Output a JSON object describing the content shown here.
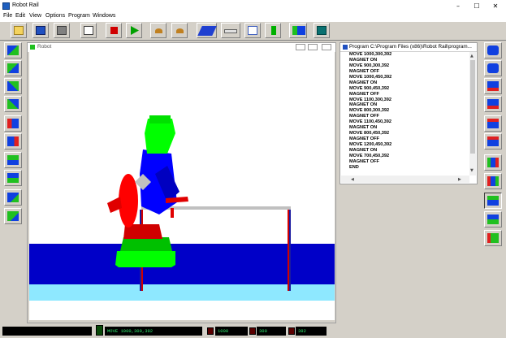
{
  "app": {
    "title": "Robot Rail"
  },
  "window_controls": {
    "minimize": "–",
    "maximize": "☐",
    "close": "✕"
  },
  "menu": [
    "File",
    "Edit",
    "View",
    "Options",
    "Program",
    "Windows"
  ],
  "robot_window": {
    "title": "Robot"
  },
  "program_window": {
    "title": "Program C:\\Program Files (x86)\\Robot Rail\\program...",
    "lines": [
      "MOVE 1000,300,392",
      "MAGNET ON",
      "MOVE 900,300,392",
      "MAGNET OFF",
      "MOVE 1000,450,392",
      "MAGNET ON",
      "MOVE 900,450,392",
      "MAGNET OFF",
      "MOVE 1100,300,392",
      "MAGNET ON",
      "MOVE 800,300,392",
      "MAGNET OFF",
      "MOVE 1100,450,392",
      "MAGNET ON",
      "MOVE 800,450,392",
      "MAGNET OFF",
      "MOVE 1200,450,392",
      "MAGNET ON",
      "MOVE 700,450,392",
      "MAGNET OFF",
      "END"
    ]
  },
  "status": {
    "command": "MOVE 1000,300,392",
    "x": "1000",
    "y": "300",
    "z": "392"
  },
  "colors": {
    "floor": "#0000c8",
    "floor_front": "#8ee8ff",
    "robot_green": "#00ff00",
    "robot_blue": "#0000ff",
    "robot_red": "#ff0000",
    "rail": "#c0c0c0"
  }
}
